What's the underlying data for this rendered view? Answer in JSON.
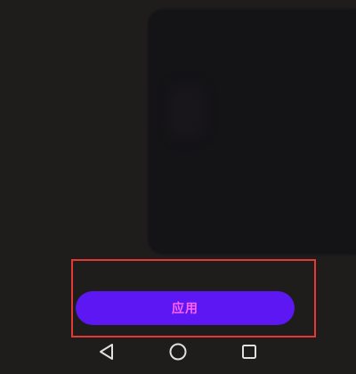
{
  "action": {
    "apply_label": "应用"
  },
  "nav": {
    "back_icon": "back-triangle-icon",
    "home_icon": "home-circle-icon",
    "recents_icon": "recents-square-icon"
  },
  "colors": {
    "background": "#1f1c1c",
    "button_bg": "#5c17f2",
    "button_text": "#ff62f4",
    "highlight": "#e53935",
    "nav_icon": "#e0e0e0"
  }
}
